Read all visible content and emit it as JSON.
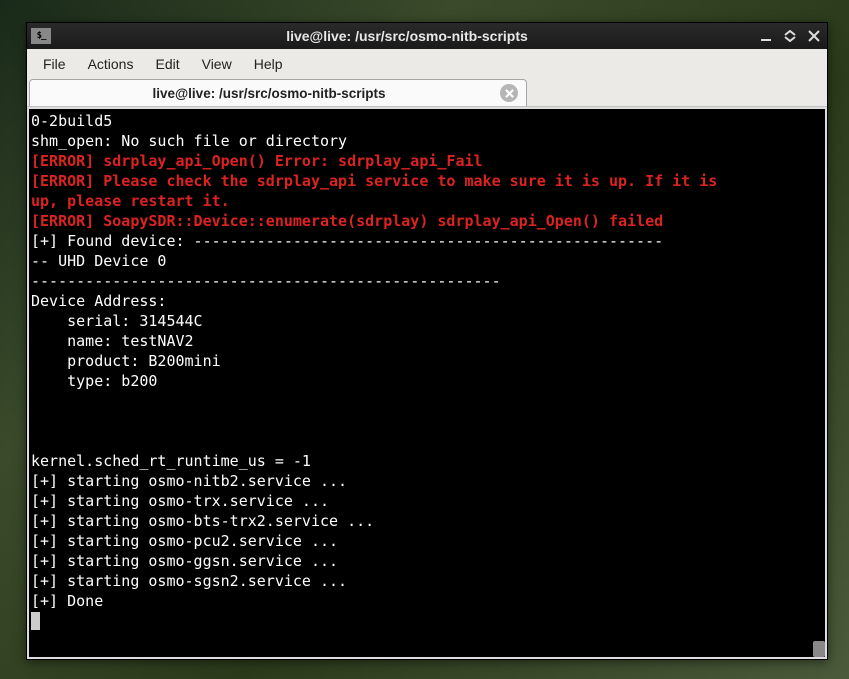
{
  "window": {
    "title": "live@live: /usr/src/osmo-nitb-scripts"
  },
  "menubar": {
    "items": [
      "File",
      "Actions",
      "Edit",
      "View",
      "Help"
    ]
  },
  "tab": {
    "title": "live@live: /usr/src/osmo-nitb-scripts"
  },
  "terminal": {
    "lines": [
      {
        "cls": "",
        "text": "0-2build5"
      },
      {
        "cls": "",
        "text": "shm_open: No such file or directory"
      },
      {
        "cls": "err",
        "text": "[ERROR] sdrplay_api_Open() Error: sdrplay_api_Fail"
      },
      {
        "cls": "err",
        "text": "[ERROR] Please check the sdrplay_api service to make sure it is up. If it is "
      },
      {
        "cls": "err",
        "text": "up, please restart it."
      },
      {
        "cls": "err",
        "text": "[ERROR] SoapySDR::Device::enumerate(sdrplay) sdrplay_api_Open() failed"
      },
      {
        "cls": "",
        "text": "[+] Found device: ----------------------------------------------------"
      },
      {
        "cls": "",
        "text": "-- UHD Device 0"
      },
      {
        "cls": "",
        "text": "----------------------------------------------------"
      },
      {
        "cls": "",
        "text": "Device Address:"
      },
      {
        "cls": "",
        "text": "    serial: 314544C"
      },
      {
        "cls": "",
        "text": "    name: testNAV2"
      },
      {
        "cls": "",
        "text": "    product: B200mini"
      },
      {
        "cls": "",
        "text": "    type: b200"
      },
      {
        "cls": "",
        "text": ""
      },
      {
        "cls": "",
        "text": ""
      },
      {
        "cls": "",
        "text": ""
      },
      {
        "cls": "",
        "text": "kernel.sched_rt_runtime_us = -1"
      },
      {
        "cls": "",
        "text": "[+] starting osmo-nitb2.service ..."
      },
      {
        "cls": "",
        "text": "[+] starting osmo-trx.service ..."
      },
      {
        "cls": "",
        "text": "[+] starting osmo-bts-trx2.service ..."
      },
      {
        "cls": "",
        "text": "[+] starting osmo-pcu2.service ..."
      },
      {
        "cls": "",
        "text": "[+] starting osmo-ggsn.service ..."
      },
      {
        "cls": "",
        "text": "[+] starting osmo-sgsn2.service ..."
      },
      {
        "cls": "",
        "text": "[+] Done"
      }
    ]
  }
}
